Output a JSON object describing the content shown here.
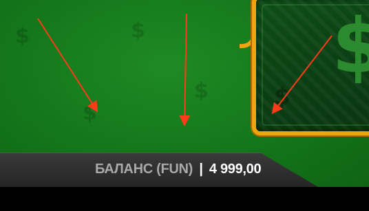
{
  "balance": {
    "label": "БАЛАНС (FUN)",
    "separator": "|",
    "value": "4 999,00"
  },
  "icons": {
    "background_pattern": "dollar-sign",
    "banknote": "dollar-banknote"
  },
  "colors": {
    "felt_green": "#157a1c",
    "frame_gold": "#f2a40f",
    "annotation_arrow": "#ff3b1a",
    "bar_background": "#2c2c2c",
    "label_gray": "#a9a9a9"
  }
}
